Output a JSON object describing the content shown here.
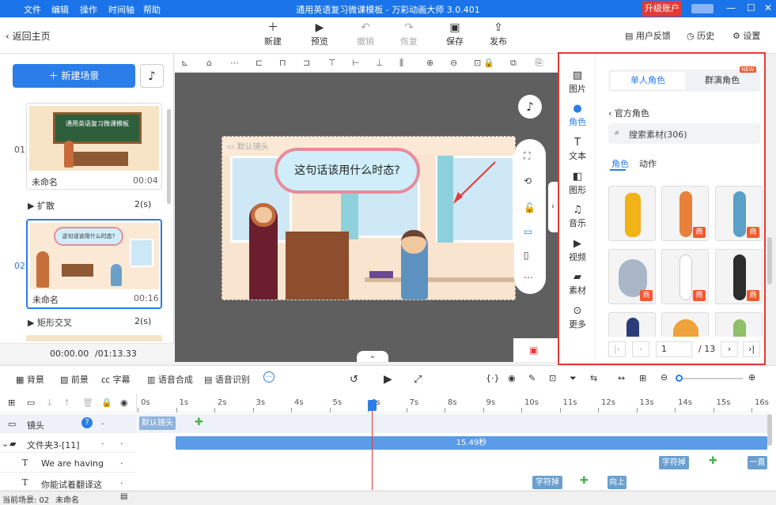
{
  "titlebar": {
    "menus": [
      "文件",
      "编辑",
      "操作",
      "时间轴",
      "帮助"
    ],
    "title": "通用英语复习微课模板 - 万彩动画大师 3.0.401",
    "upgrade_label": "升级账户"
  },
  "toolbar": {
    "back_label": "返回主页",
    "buttons": [
      {
        "label": "新建",
        "icon": "plus-icon"
      },
      {
        "label": "预览",
        "icon": "play-icon"
      },
      {
        "label": "撤销",
        "icon": "undo-icon"
      },
      {
        "label": "恢复",
        "icon": "redo-icon"
      },
      {
        "label": "保存",
        "icon": "save-icon"
      },
      {
        "label": "发布",
        "icon": "publish-icon"
      }
    ],
    "feedback_label": "用户反馈",
    "history_label": "历史",
    "settings_label": "设置"
  },
  "left_panel": {
    "new_scene_label": "新建场景",
    "scenes": [
      {
        "number": "01",
        "thumb_title": "通用英语复习微课模板",
        "name": "未命名",
        "duration": "00:04",
        "transition": "扩散",
        "transition_duration": "2(s)"
      },
      {
        "number": "02",
        "thumb_title": "这句话该用什么时态?",
        "name": "未命名",
        "duration": "00:16",
        "transition": "矩形交叉",
        "transition_duration": "2(s)"
      }
    ],
    "time_current": "00:00.00",
    "time_total": "/01:13.33"
  },
  "stage": {
    "lens_label": "默认镜头",
    "speech_text": "这句话该用什么时态?"
  },
  "right_panel": {
    "categories": [
      {
        "label": "图片",
        "icon": "image-icon"
      },
      {
        "label": "角色",
        "icon": "character-icon"
      },
      {
        "label": "文本",
        "icon": "text-icon"
      },
      {
        "label": "图形",
        "icon": "shape-icon"
      },
      {
        "label": "音乐",
        "icon": "music-icon"
      },
      {
        "label": "视频",
        "icon": "video-icon"
      },
      {
        "label": "素材",
        "icon": "folder-icon"
      },
      {
        "label": "更多",
        "icon": "more-icon"
      }
    ],
    "tab_single": "单人角色",
    "tab_group": "群演角色",
    "new_badge": "NEW",
    "back_label": "官方角色",
    "search_placeholder": "搜索素材(306)",
    "subtab_role": "角色",
    "subtab_action": "动作",
    "premium_badge": "商",
    "page_current": "1",
    "page_total": "/ 13"
  },
  "timeline_tools": {
    "background": "背景",
    "foreground": "前景",
    "caption": "字幕",
    "tts": "语音合成",
    "asr": "语音识别"
  },
  "timeline": {
    "ticks": [
      "0s",
      "1s",
      "2s",
      "3s",
      "4s",
      "5s",
      "6s",
      "7s",
      "8s",
      "9s",
      "10s",
      "11s",
      "12s",
      "13s",
      "14s",
      "15s",
      "16s"
    ],
    "tracks": [
      {
        "label": "镜头"
      },
      {
        "label": "文件夹3-[11]"
      },
      {
        "label": "We are having"
      },
      {
        "label": "你能试着翻译这"
      }
    ],
    "lens_chip": "默认镜头",
    "folder_duration": "15.49秒",
    "chip_typewriter": "字符掉",
    "chip_up": "向上",
    "chip_straight": "一直"
  },
  "status": {
    "current_scene": "当前场景: 02",
    "scene_name": "未命名"
  },
  "colors": {
    "accent": "#1a73e8",
    "highlight": "#e53935",
    "premium": "#f25a2c"
  }
}
